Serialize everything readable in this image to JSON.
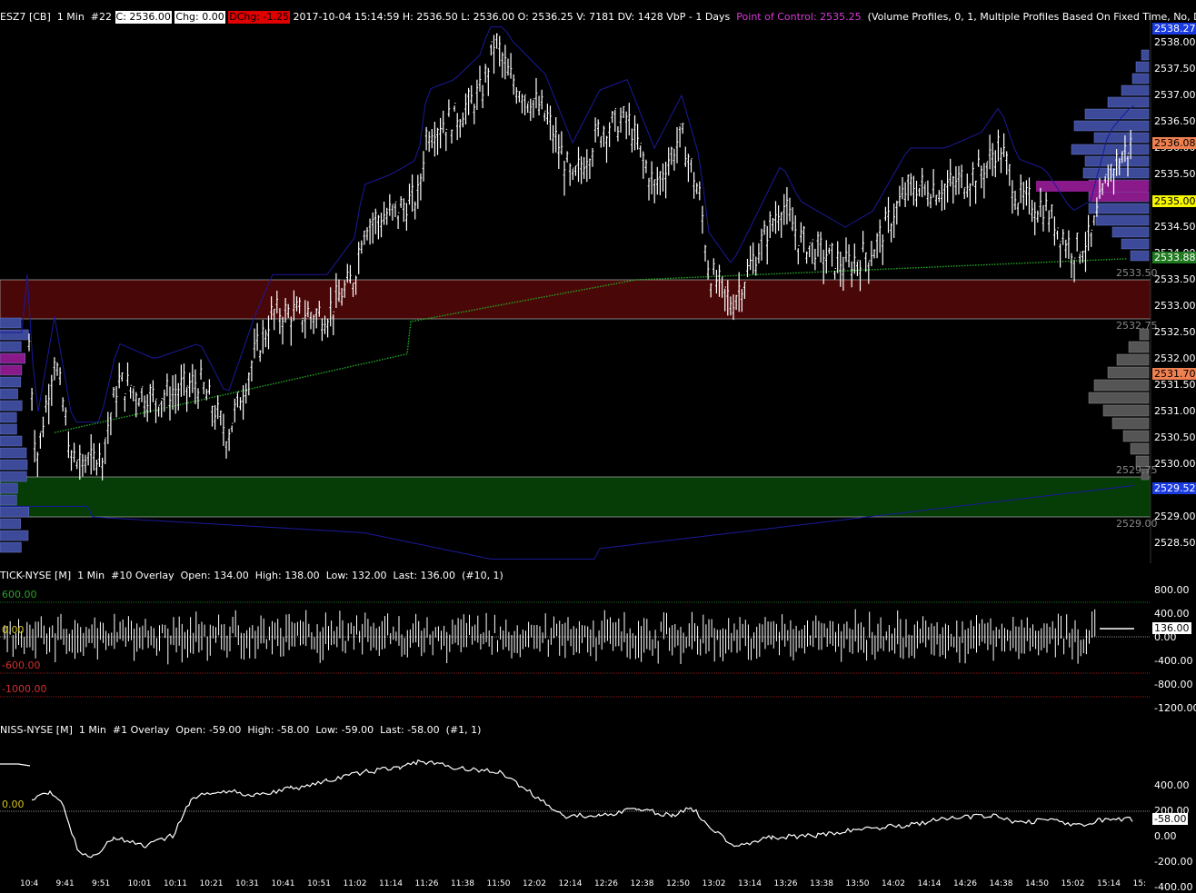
{
  "main_header": {
    "symbol": "ESZ7 [CB]",
    "interval": "1 Min",
    "index": "#22",
    "close": "C: 2536.00",
    "chg": "Chg: 0.00",
    "dchg": "DChg: -1.25",
    "datetime": "2017-10-04 15:14:59",
    "high": "H: 2536.50",
    "low": "L: 2536.00",
    "open": "O: 2536.25",
    "volume": "V: 7181",
    "dv": "DV: 1428",
    "vbp": "VbP - 1 Days",
    "poc": "Point of Control: 2535.25",
    "study": "(Volume Profiles, 0, 1, Multiple Profiles Based On Fixed Time, No, Days, 1, 50"
  },
  "main_axis": [
    "2538.00",
    "2537.50",
    "2537.00",
    "2536.50",
    "2536.00",
    "2535.50",
    "2535.00",
    "2534.50",
    "2534.00",
    "2533.50",
    "2533.00",
    "2532.50",
    "2532.00",
    "2531.50",
    "2531.00",
    "2530.50",
    "2530.00",
    "2529.50",
    "2529.00",
    "2528.50"
  ],
  "main_tags": {
    "top_blue": "2538.27",
    "last_price": "2536.08",
    "poc_tag": "2535.00",
    "green_tag": "2533.88",
    "zone_top": "2533.50",
    "zone_bottom": "2532.75",
    "orange_tag": "2531.70",
    "zone2_top": "2529.75",
    "blue_low": "2529.52",
    "zone2_bottom": "2529.00"
  },
  "tick_header": {
    "symbol": "TICK-NYSE [M]",
    "interval": "1 Min",
    "overlay": "#10 Overlay",
    "open": "Open: 134.00",
    "high": "High: 138.00",
    "low": "Low: 132.00",
    "last": "Last: 136.00",
    "params": "(#10, 1)"
  },
  "tick_levels": {
    "plus600": "600.00",
    "zero": "0.00",
    "minus600": "-600.00",
    "minus1000": "-1000.00"
  },
  "tick_axis": [
    "800.00",
    "400.00",
    "0.00",
    "-400.00",
    "-800.00",
    "-1200.00"
  ],
  "tick_last": "136.00",
  "niss_header": {
    "symbol": "NISS-NYSE [M]",
    "interval": "1 Min",
    "overlay": "#1 Overlay",
    "open": "Open: -59.00",
    "high": "High: -58.00",
    "low": "Low: -59.00",
    "last": "Last: -58.00",
    "params": "(#1, 1)"
  },
  "niss_zero": "0.00",
  "niss_axis": [
    "400.00",
    "200.00",
    "0.00",
    "-200.00",
    "-400.00"
  ],
  "niss_last": "-58.00",
  "time_axis": [
    "10:4",
    "9:41",
    "9:51",
    "10:01",
    "10:11",
    "10:21",
    "10:31",
    "10:41",
    "10:51",
    "11:02",
    "11:14",
    "11:26",
    "11:38",
    "11:50",
    "12:02",
    "12:14",
    "12:26",
    "12:38",
    "12:50",
    "13:02",
    "13:14",
    "13:26",
    "13:38",
    "13:50",
    "14:02",
    "14:14",
    "14:26",
    "14:38",
    "14:50",
    "15:02",
    "15:14",
    "15:"
  ],
  "colors": {
    "background": "#000000",
    "resistance_zone": "#4a0707",
    "support_zone": "#063c06",
    "profile_blue": "#3d4a9a",
    "profile_poc": "#8a1a8a",
    "profile_gray": "#555555",
    "vwap": "#22aa22",
    "band": "#1a1a9a"
  }
}
